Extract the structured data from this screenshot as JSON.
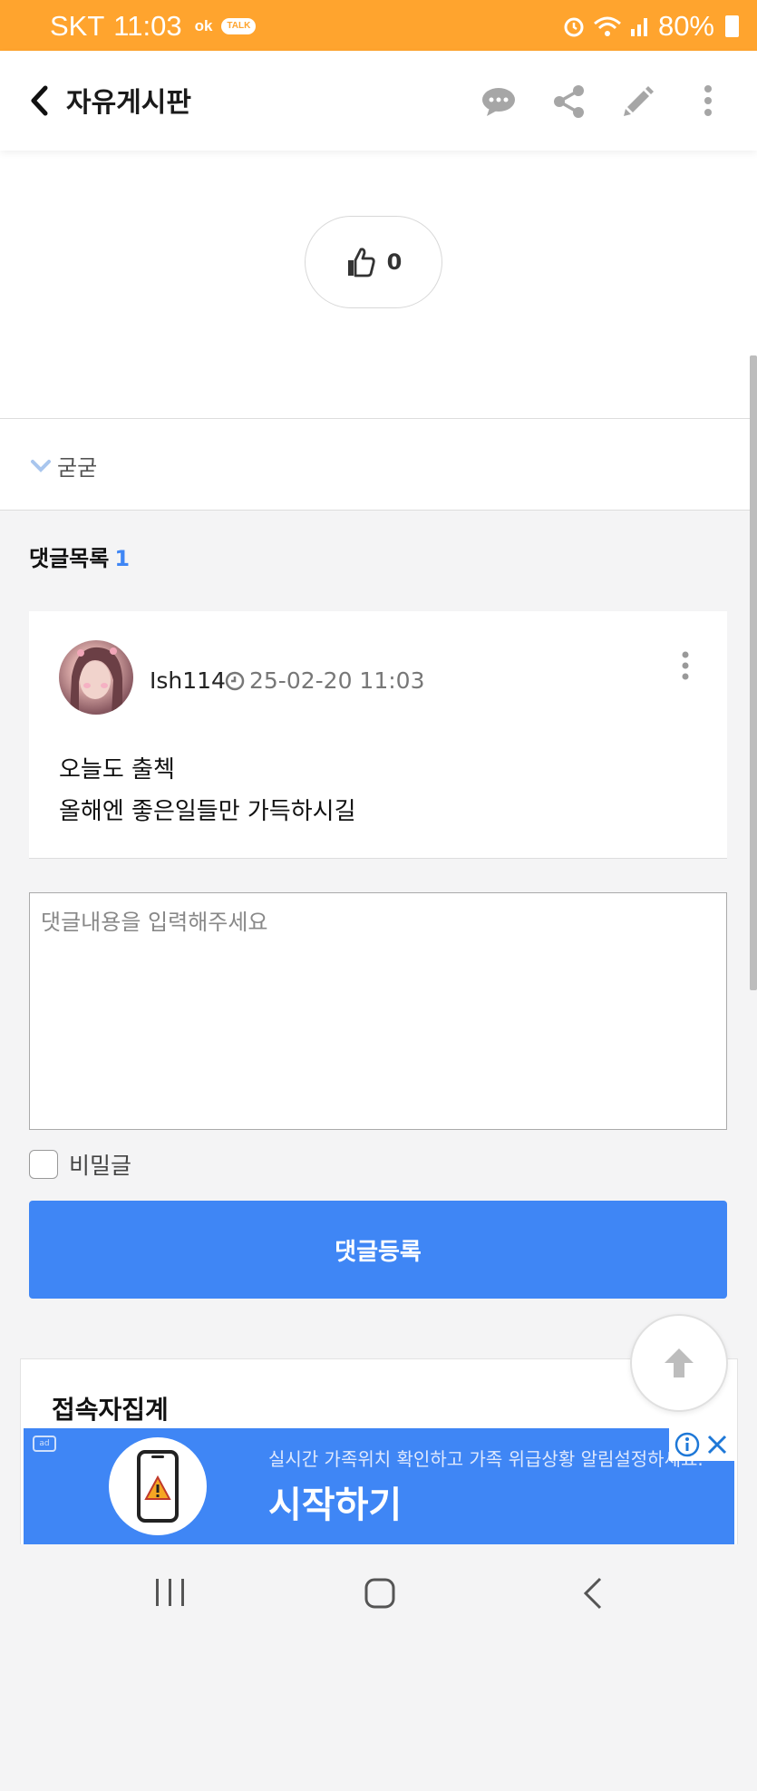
{
  "status_bar": {
    "carrier": "SKT",
    "time": "11:03",
    "battery": "80%"
  },
  "header": {
    "title": "자유게시판"
  },
  "post": {
    "like_count": "0",
    "tag": "굳굳"
  },
  "comments": {
    "title": "댓글목록",
    "count": "1",
    "items": [
      {
        "author": "Ish114",
        "datetime": "25-02-20 11:03",
        "lines": [
          "오늘도 출첵",
          "올해엔 좋은일들만 가득하시길"
        ]
      }
    ]
  },
  "comment_form": {
    "placeholder": "댓글내용을 입력해주세요",
    "value": "",
    "secret_label": "비밀글",
    "submit_label": "댓글등록"
  },
  "stats": {
    "title": "접속자집계"
  },
  "ad": {
    "description": "실시간 가족위치 확인하고 가족 위급상황 알림설정하세요.",
    "cta": "시작하기"
  },
  "colors": {
    "status_bar": "#ffa42e",
    "accent": "#3f86f5"
  },
  "icons": [
    "back-arrow-icon",
    "comment-icon",
    "share-icon",
    "edit-icon",
    "more-vertical-icon",
    "thumbs-up-icon",
    "chevron-down-icon",
    "clock-icon",
    "arrow-up-icon",
    "info-icon",
    "close-icon"
  ]
}
